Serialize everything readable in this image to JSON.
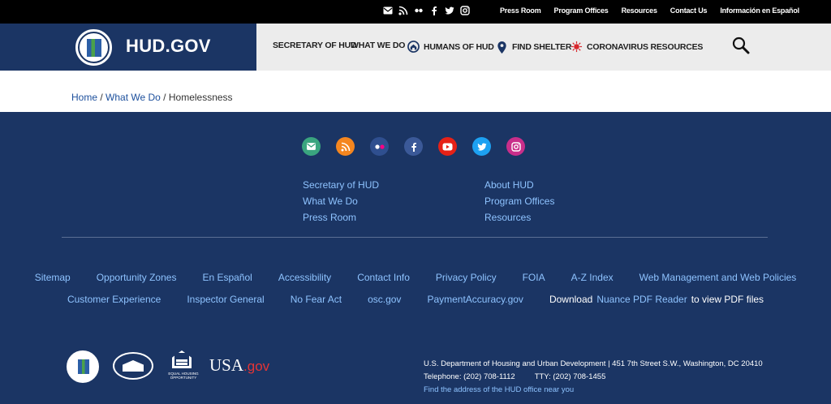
{
  "topbar": {
    "icons": [
      "email-icon",
      "rss-icon",
      "flickr-icon",
      "facebook-icon",
      "twitter-icon",
      "instagram-icon"
    ],
    "links": [
      "Press Room",
      "Program Offices",
      "Resources",
      "Contact Us",
      "Información en Español"
    ]
  },
  "header": {
    "brand": "HUD.GOV",
    "nav": [
      {
        "label": "SECRETARY OF HUD",
        "icon": ""
      },
      {
        "label": "WHAT WE DO",
        "icon": ""
      },
      {
        "label": "HUMANS OF HUD",
        "icon": "home-icon"
      },
      {
        "label": "FIND SHELTER",
        "icon": "location-pin-icon"
      },
      {
        "label": "CORONAVIRUS RESOURCES",
        "icon": "virus-icon"
      }
    ]
  },
  "breadcrumb": {
    "items": [
      "Home",
      "What We Do",
      "Homelessness"
    ],
    "separator": " / "
  },
  "footer": {
    "social_colors": [
      "#3aa57f",
      "#f5861f",
      "#2f4f8f",
      "#3b5998",
      "#e62117",
      "#1da1f2",
      "#c92e8a"
    ],
    "col1": [
      "Secretary of HUD",
      "What We Do",
      "Press Room"
    ],
    "col2": [
      "About HUD",
      "Program Offices",
      "Resources"
    ],
    "links_row1": [
      "Sitemap",
      "Opportunity Zones",
      "En Español",
      "Accessibility",
      "Contact Info",
      "Privacy Policy",
      "FOIA",
      "A-Z Index",
      "Web Management and Web Policies"
    ],
    "links_row2": [
      "Customer Experience",
      "Inspector General",
      "No Fear Act",
      "osc.gov",
      "PaymentAccuracy.gov"
    ],
    "download_prefix": "Download",
    "download_link": "Nuance PDF Reader",
    "download_suffix": "to view PDF files",
    "logo_eho_caption": "EQUAL HOUSING OPPORTUNITY",
    "logo_usa": "USA",
    "logo_gov": ".gov",
    "address_line": "U.S. Department of Housing and Urban Development | 451 7th Street S.W., Washington, DC 20410",
    "telephone": "Telephone: (202) 708-1112",
    "tty": "TTY: (202) 708-1455",
    "office_link": "Find the address of the HUD office near you"
  }
}
